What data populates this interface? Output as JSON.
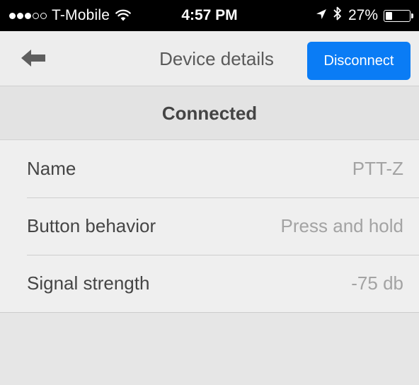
{
  "status_bar": {
    "signal_bars": 3,
    "signal_total": 5,
    "carrier": "T-Mobile",
    "time": "4:57 PM",
    "battery_percent": "27%",
    "battery_level": 0.27,
    "icons": [
      "wifi-icon",
      "location-arrow-icon",
      "bluetooth-icon",
      "battery-icon"
    ]
  },
  "nav": {
    "back_icon": "arrow-left-icon",
    "title": "Device details",
    "disconnect_label": "Disconnect"
  },
  "section": {
    "header": "Connected"
  },
  "details": [
    {
      "label": "Name",
      "value": "PTT-Z"
    },
    {
      "label": "Button behavior",
      "value": "Press and hold"
    },
    {
      "label": "Signal strength",
      "value": "-75 db"
    }
  ],
  "colors": {
    "accent": "#0a7cf5",
    "status_bar_bg": "#000000",
    "nav_bg": "#ededed",
    "section_bg": "#e3e3e3",
    "row_bg": "#efefef"
  }
}
